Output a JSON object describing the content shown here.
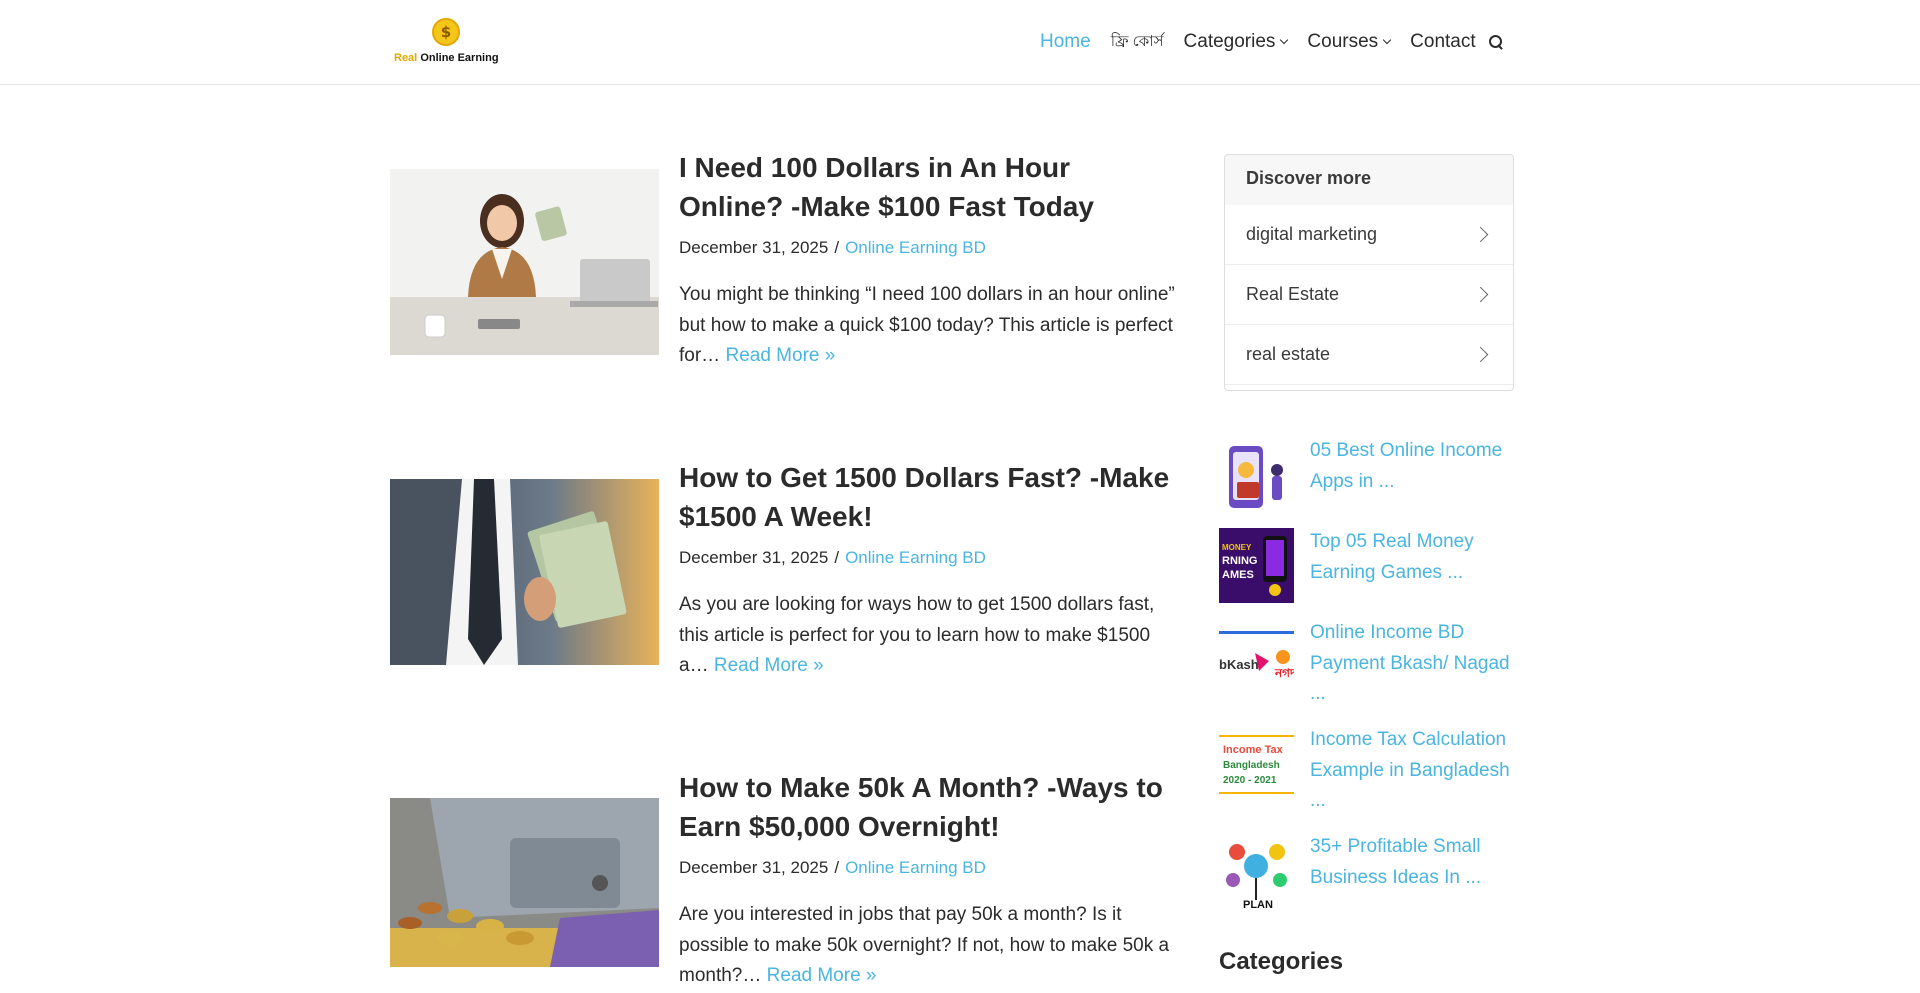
{
  "site": {
    "logo_prefix": "Real",
    "logo_name": "Online Earning",
    "coin_symbol": "$"
  },
  "nav": {
    "items": [
      {
        "label": "Home",
        "active": true
      },
      {
        "label": "ফ্রি কোর্স"
      },
      {
        "label": "Categories",
        "dropdown": true
      },
      {
        "label": "Courses",
        "dropdown": true
      },
      {
        "label": "Contact"
      }
    ],
    "search_icon": "search-icon"
  },
  "posts": [
    {
      "title": "I Need 100 Dollars in An Hour Online? -Make $100 Fast Today",
      "date": "December 31, 2025",
      "separator": "/",
      "category": "Online Earning BD",
      "excerpt": "You might be thinking “I need 100 dollars in an hour online” but how to make a quick $100 today? This article is perfect for…",
      "read_more": "Read More »"
    },
    {
      "title": "How to Get 1500 Dollars Fast? -Make $1500 A Week!",
      "date": "December 31, 2025",
      "separator": "/",
      "category": "Online Earning BD",
      "excerpt": "As you are looking for ways how to get 1500 dollars fast, this article is perfect for you to learn how to make $1500 a…",
      "read_more": "Read More »"
    },
    {
      "title": "How to Make 50k A Month? -Ways to Earn $50,000 Overnight!",
      "date": "December 31, 2025",
      "separator": "/",
      "category": "Online Earning BD",
      "excerpt": "Are you interested in jobs that pay 50k a month? Is it possible to make 50k overnight? If not, how to make 50k a month?…",
      "read_more": "Read More »"
    }
  ],
  "discover": {
    "heading": "Discover more",
    "items": [
      "digital marketing",
      "Real Estate",
      "real estate"
    ]
  },
  "recent_posts": [
    {
      "title": "05 Best Online Income Apps in ..."
    },
    {
      "title": "Top 05 Real Money Earning Games ...",
      "thumb_text": "MONEY\nRNING\nAMES"
    },
    {
      "title": "Online Income BD Payment Bkash/ Nagad ...",
      "thumb_text": "bKash"
    },
    {
      "title": "Income Tax Calculation Example in Bangladesh ...",
      "thumb_text": "Income Tax\nBangladesh\n2020 - 2021"
    },
    {
      "title": "35+ Profitable Small Business Ideas In ...",
      "thumb_text": "PLAN"
    }
  ],
  "sidebar": {
    "categories_heading": "Categories"
  }
}
